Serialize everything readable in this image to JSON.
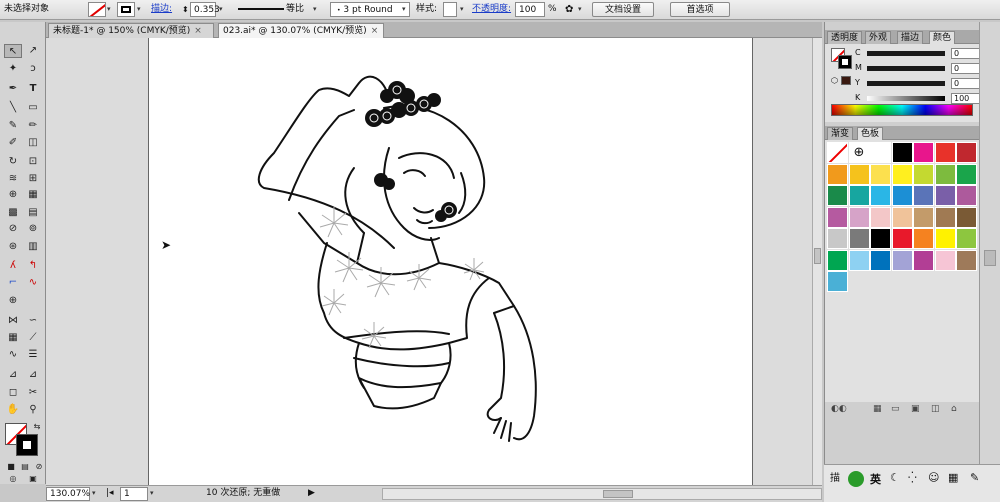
{
  "control_bar": {
    "selection_status": "未选择对象",
    "stroke_label": "描边:",
    "stroke_weight": "0.353",
    "stroke_profile": "等比",
    "brush": "3 pt Round",
    "style_label": "样式:",
    "opacity_label": "不透明度:",
    "opacity_value": "100",
    "opacity_unit": "%",
    "doc_setup_button": "文档设置",
    "preferences_button": "首选项"
  },
  "tabs": [
    {
      "label": "未标题-1* @ 150% (CMYK/预览)",
      "close": "×"
    },
    {
      "label": "023.ai* @ 130.07% (CMYK/预览)",
      "close": "×"
    }
  ],
  "status_bar": {
    "zoom": "130.07%",
    "artboard": "1",
    "status_text": "10 次还原; 无重做"
  },
  "color_panel": {
    "tabs": [
      "透明度",
      "外观",
      "描边",
      "颜色"
    ],
    "channels": [
      {
        "label": "C",
        "value": "0"
      },
      {
        "label": "M",
        "value": "0"
      },
      {
        "label": "Y",
        "value": "0"
      },
      {
        "label": "K",
        "value": "100"
      }
    ],
    "unit": "%"
  },
  "swatch_panel": {
    "tabs": [
      "渐变",
      "色板"
    ],
    "swatches": [
      "#ffffff",
      "#ffffff",
      "#ffffff",
      "#000000",
      "#e8168c",
      "#e8322a",
      "#c0282f",
      "#f19a1c",
      "#f5c21c",
      "#fce04e",
      "#ffef1f",
      "#c4d930",
      "#7dbb3e",
      "#1aa54b",
      "#1a8a4a",
      "#17a6a0",
      "#2ab6e6",
      "#1c8fd5",
      "#5a74b8",
      "#7a5fa8",
      "#ad5a9c",
      "#b55aa0",
      "#d6a3c8",
      "#f3c7c8",
      "#f0c39a",
      "#c39b6a",
      "#a07a53",
      "#7a5a35",
      "#c8c8c8",
      "#7a7a7a",
      "#000000",
      "#e8192b",
      "#f58220",
      "#fff200",
      "#8dc63f",
      "#00a651",
      "#8ed1f2",
      "#0072bc",
      "#a3a3d6",
      "#b23e95",
      "#f6c5d5",
      "#9e7a5a",
      "#4ab0d6"
    ]
  },
  "icons": {
    "selection": "selection-tool-icon",
    "direct": "direct-selection-icon"
  }
}
